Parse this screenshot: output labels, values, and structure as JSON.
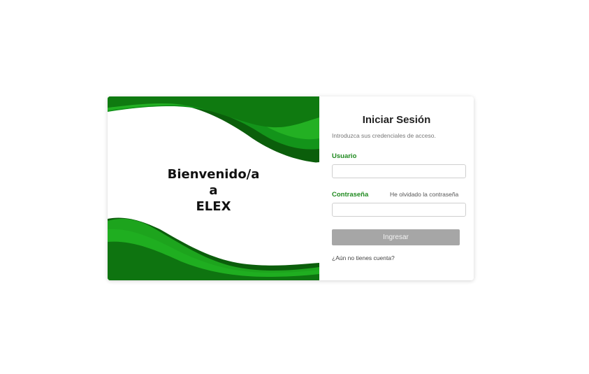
{
  "welcome": {
    "line1": "Bienvenido/a",
    "line2": "a",
    "line3": "ELEX"
  },
  "login": {
    "title": "Iniciar Sesión",
    "subtitle": "Introduzca sus credenciales de acceso.",
    "username_label": "Usuario",
    "username_value": "",
    "password_label": "Contraseña",
    "password_value": "",
    "forgot_link": "He olvidado la contraseña",
    "submit_label": "Ingresar",
    "signup_link": "¿Aún no tienes cuenta?"
  },
  "colors": {
    "accent_green": "#1f8a1f",
    "button_disabled": "#a6a6a6",
    "wave_dark": "#0b5e0b",
    "wave_mid": "#138c13",
    "wave_light": "#1fae1f"
  }
}
